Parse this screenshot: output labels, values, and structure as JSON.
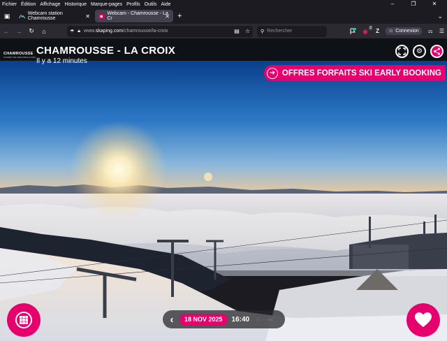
{
  "menubar": {
    "items": [
      "Fichier",
      "Édition",
      "Affichage",
      "Historique",
      "Marque-pages",
      "Profils",
      "Outils",
      "Aide"
    ]
  },
  "tabs": [
    {
      "label": "Webcam station Chamrousse",
      "active": false
    },
    {
      "label": "Webcam - Chamrousse - La Cr",
      "active": true
    }
  ],
  "navbar": {
    "url_prefix": "www.",
    "url_host": "skaping.com",
    "url_path": "/chamrousse/la-croix",
    "search_placeholder": "Rechercher",
    "connexion_label": "Connexion",
    "extension_badge": "2"
  },
  "page": {
    "logo_text": "CHAMROUSSE",
    "logo_sub": "SOMMET DE GRENOBLE ALPES",
    "title": "CHAMROUSSE - LA CROIX",
    "subtitle": "Il y a 12 minutes",
    "promo_label": "OFFRES FORFAITS SKI EARLY BOOKING",
    "date_label": "18 NOV 2025",
    "time_label": "16:40"
  },
  "colors": {
    "accent": "#e6006e",
    "chrome_dark": "#1c1b22",
    "chrome_toolbar": "#2b2a33"
  },
  "icons": {
    "fullscreen": "fullscreen-icon",
    "settings": "gear-icon",
    "share": "share-icon",
    "grid": "grid-icon",
    "heart": "heart-icon"
  }
}
